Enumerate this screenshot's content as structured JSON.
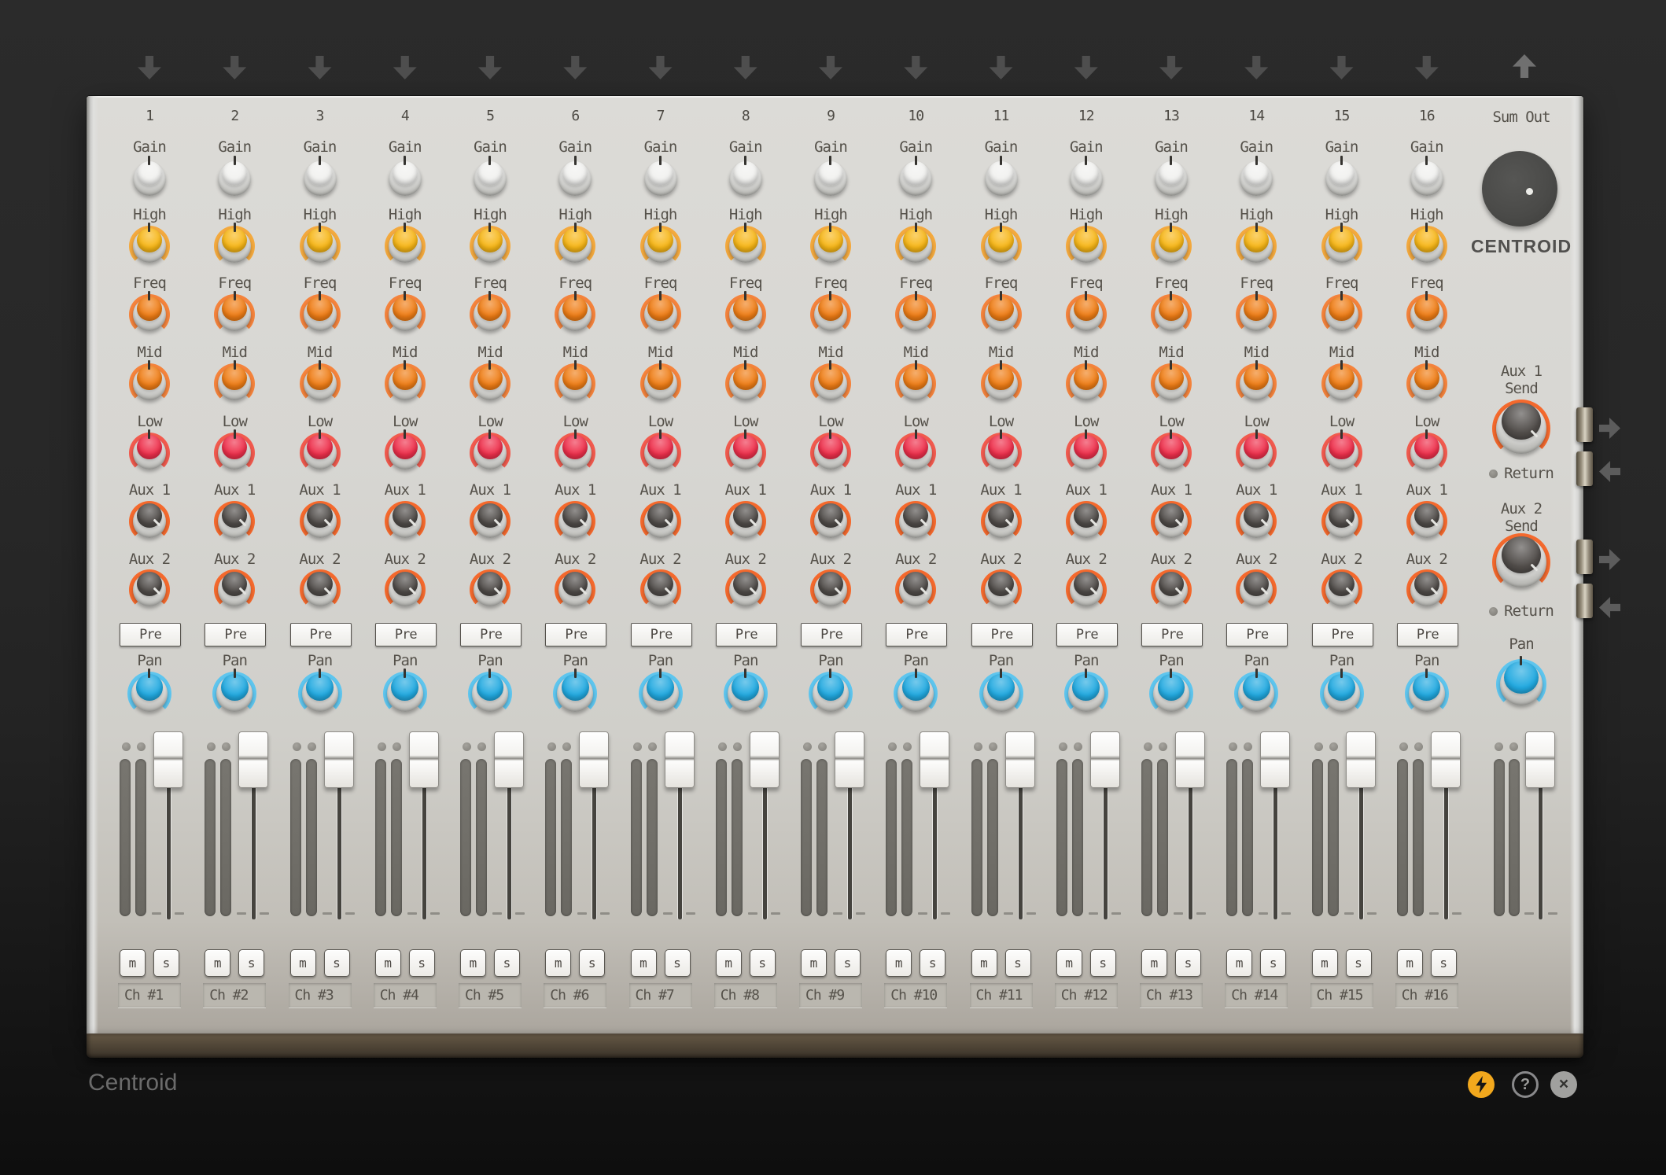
{
  "window": {
    "title": "Centroid"
  },
  "statusbar": {
    "title": "Centroid",
    "help_glyph": "?",
    "close_glyph": "×",
    "icons": [
      {
        "name": "power-lightning-icon",
        "color": "#f2a81d"
      },
      {
        "name": "help-icon",
        "color": "#89898b"
      },
      {
        "name": "close-icon",
        "color": "#a0a09e"
      }
    ]
  },
  "colors": {
    "background": "#262626",
    "panel": "#d6d5d1",
    "panel_base": "#554a3a",
    "accent_orange": "#f4692d",
    "accent_blue": "#21a9e0"
  },
  "mixer": {
    "channel_count": 16,
    "knob_rows": [
      {
        "id": "gain",
        "label": "Gain",
        "cap_color": "#f1f1ef",
        "arc_color": null
      },
      {
        "id": "high",
        "label": "High",
        "cap_color": "#f7b616",
        "arc_color": "#f3a93e"
      },
      {
        "id": "freq",
        "label": "Freq",
        "cap_color": "#ef7d15",
        "arc_color": "#f4833c"
      },
      {
        "id": "mid",
        "label": "Mid",
        "cap_color": "#ef7d15",
        "arc_color": "#f4833c"
      },
      {
        "id": "low",
        "label": "Low",
        "cap_color": "#ee2f4b",
        "arc_color": "#f15a4e"
      },
      {
        "id": "aux1",
        "label": "Aux 1",
        "cap_color": "#504c49",
        "arc_color": "#f4692d"
      },
      {
        "id": "aux2",
        "label": "Aux 2",
        "cap_color": "#504c49",
        "arc_color": "#f4692d"
      }
    ],
    "pre_label": "Pre",
    "pan_label": "Pan",
    "pan_cap_color": "#21a9e0",
    "pan_arc_color": "#5ec5ee",
    "mute_label": "m",
    "solo_label": "s",
    "channels": [
      {
        "number": "1",
        "name": "Ch #1"
      },
      {
        "number": "2",
        "name": "Ch #2"
      },
      {
        "number": "3",
        "name": "Ch #3"
      },
      {
        "number": "4",
        "name": "Ch #4"
      },
      {
        "number": "5",
        "name": "Ch #5"
      },
      {
        "number": "6",
        "name": "Ch #6"
      },
      {
        "number": "7",
        "name": "Ch #7"
      },
      {
        "number": "8",
        "name": "Ch #8"
      },
      {
        "number": "9",
        "name": "Ch #9"
      },
      {
        "number": "10",
        "name": "Ch #10"
      },
      {
        "number": "11",
        "name": "Ch #11"
      },
      {
        "number": "12",
        "name": "Ch #12"
      },
      {
        "number": "13",
        "name": "Ch #13"
      },
      {
        "number": "14",
        "name": "Ch #14"
      },
      {
        "number": "15",
        "name": "Ch #15"
      },
      {
        "number": "16",
        "name": "Ch #16"
      }
    ]
  },
  "master": {
    "sum_out_label": "Sum Out",
    "brand": "CENTROID",
    "aux1": {
      "line1": "Aux 1",
      "line2": "Send",
      "return_label": "Return"
    },
    "aux2": {
      "line1": "Aux 2",
      "line2": "Send",
      "return_label": "Return"
    },
    "pan_label": "Pan"
  }
}
